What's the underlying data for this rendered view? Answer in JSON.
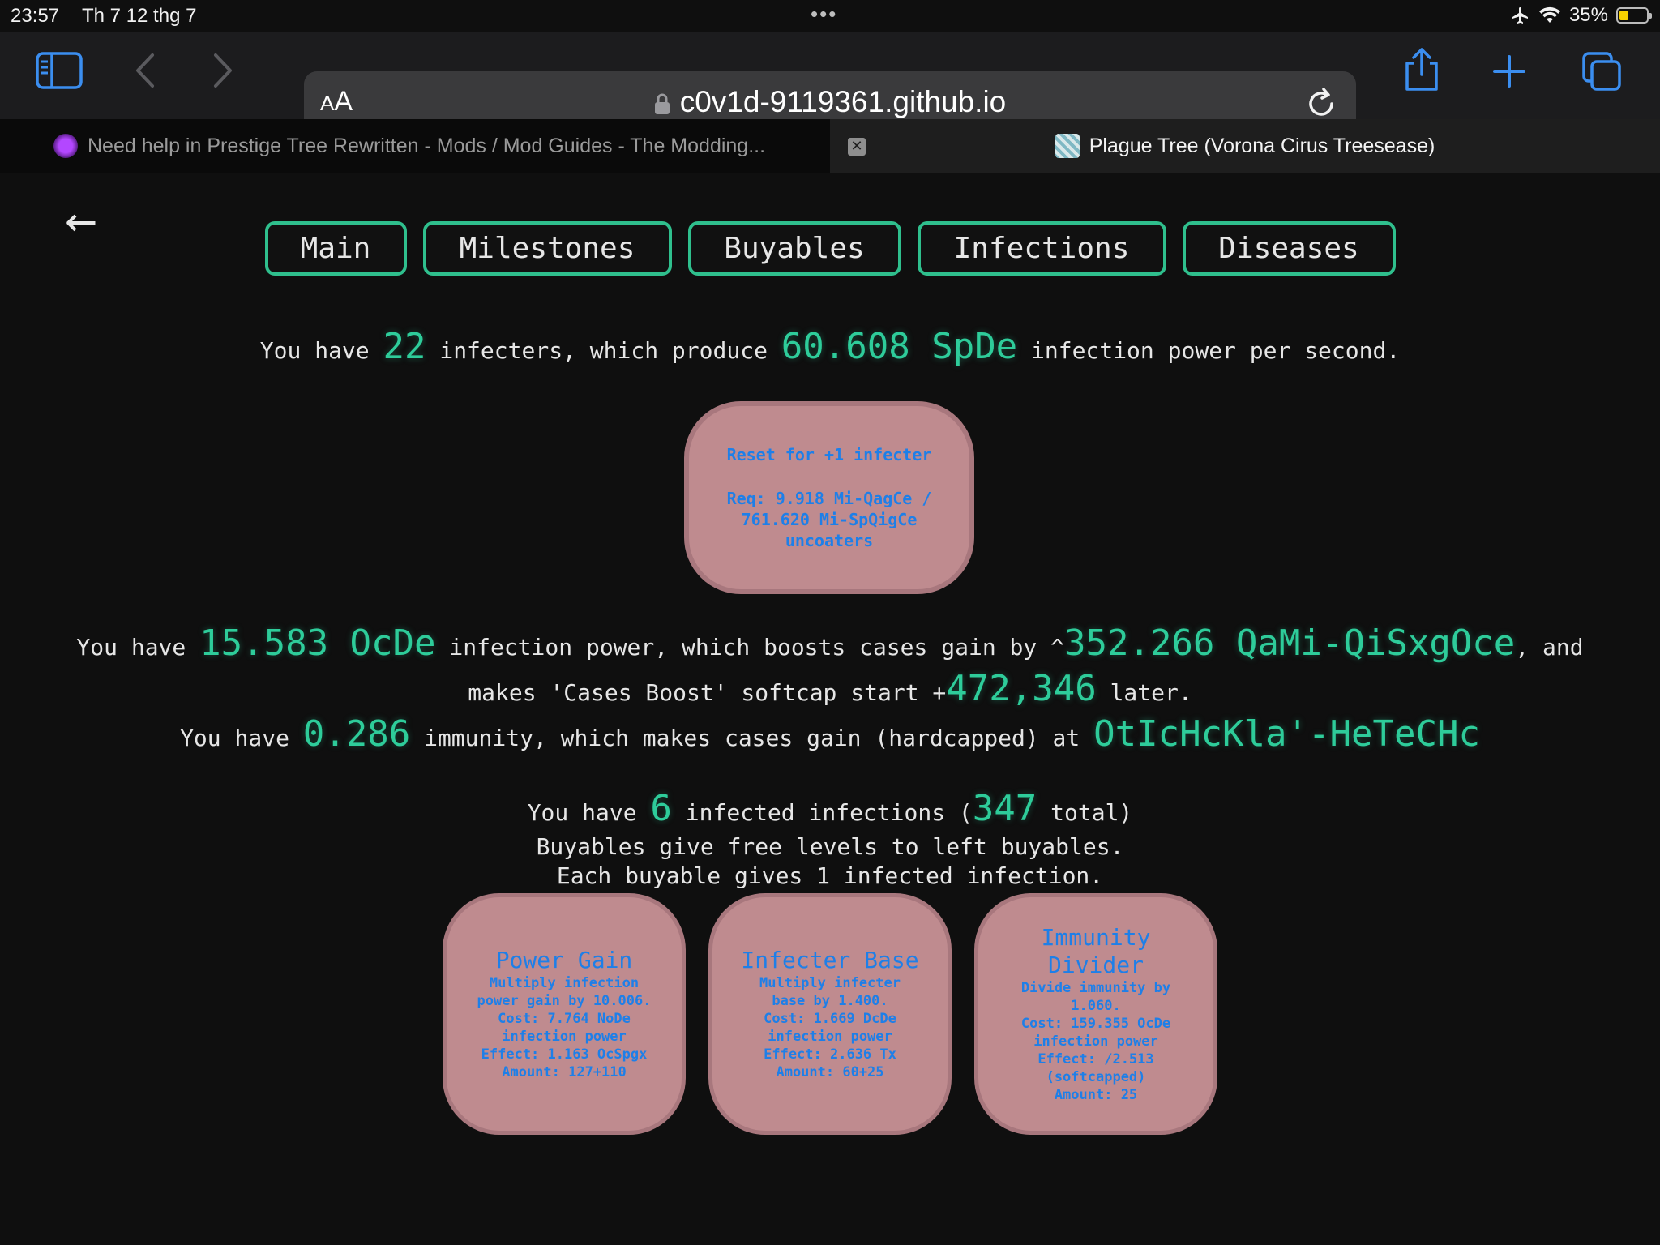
{
  "status_bar": {
    "time": "23:57",
    "date": "Th 7 12 thg 7",
    "battery": "35%",
    "battery_level": 0.35
  },
  "browser": {
    "text_size_label_small": "A",
    "text_size_label_large": "A",
    "url": "c0v1d-9119361.github.io"
  },
  "tabs": [
    {
      "title": "Need help in Prestige Tree Rewritten - Mods / Mod Guides - The Modding...",
      "active": false
    },
    {
      "title": "Plague Tree (Vorona Cirus Treesease)",
      "active": true
    }
  ],
  "page": {
    "back_arrow": "←",
    "nav": [
      "Main",
      "Milestones",
      "Buyables",
      "Infections",
      "Diseases"
    ],
    "infecters": {
      "p1": "You have ",
      "count": "22",
      "p2": " infecters, which produce ",
      "rate": "60.608 SpDe",
      "p3": " infection power per second."
    },
    "reset": {
      "line1": "Reset for +1 infecter",
      "line2": "Req: 9.918 Mi-QagCe /",
      "line3": "761.620 Mi-SpQigCe",
      "line4": "uncoaters"
    },
    "power": {
      "p1": "You have ",
      "amount": "15.583 OcDe",
      "p2": " infection power, which boosts cases gain by ^",
      "boost": "352.266 QaMi-QiSxgOce",
      "p3": ", and",
      "p4": "makes 'Cases Boost' softcap start +",
      "softcap": "472,346",
      "p5": " later."
    },
    "immunity": {
      "p1": "You have ",
      "amount": "0.286",
      "p2": " immunity, which makes cases gain (hardcapped) at ",
      "cap": "OtIcHcKla'-HeTeCHc"
    },
    "infections": {
      "p1": "You have ",
      "count": "6",
      "p2": " infected infections (",
      "total": "347",
      "p3": " total)",
      "line2": "Buyables give free levels to left buyables.",
      "line3": "Each buyable gives 1 infected infection."
    },
    "buyables": [
      {
        "title": "Power Gain",
        "desc": [
          "Multiply infection",
          "power gain by 10.006.",
          "Cost: 7.764 NoDe",
          "infection power",
          "Effect: 1.163 OcSpgx",
          "Amount: 127+110"
        ]
      },
      {
        "title": "Infecter Base",
        "desc": [
          "Multiply infecter",
          "base by 1.400.",
          "Cost: 1.669 DcDe",
          "infection power",
          "Effect: 2.636 Tx",
          "Amount: 60+25"
        ]
      },
      {
        "title": "Immunity Divider",
        "desc": [
          "Divide immunity by",
          "1.060.",
          "Cost: 159.355 OcDe",
          "infection power",
          "Effect: /2.513",
          "(softcapped)",
          "Amount: 25"
        ]
      }
    ]
  },
  "colors": {
    "accent": "#2ecc9a",
    "nav_border": "#2fbf8d",
    "button_bg": "#bf8b8f",
    "button_text": "#1e7fe8",
    "battery": "#f5d000"
  }
}
